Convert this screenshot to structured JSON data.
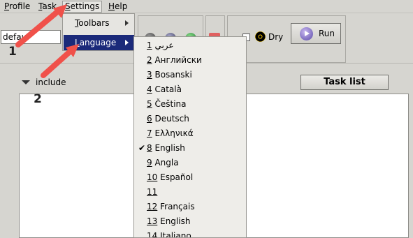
{
  "menubar": [
    {
      "label": "Profile",
      "underline": "P",
      "rest": "rofile"
    },
    {
      "label": "Task",
      "underline": "T",
      "rest": "ask"
    },
    {
      "label": "Settings",
      "underline": "S",
      "rest": "ettings"
    },
    {
      "label": "Help",
      "underline": "H",
      "rest": "elp"
    }
  ],
  "profile_field": {
    "value": "defaul"
  },
  "toolbar": {
    "dry_label": "Dry",
    "run_label": "Run"
  },
  "tree": {
    "include_label": "include"
  },
  "task_list_button": "Task list",
  "settings_menu": {
    "items": [
      {
        "underline": "T",
        "rest": "oolbars"
      },
      {
        "underline": "L",
        "rest": "anguage"
      }
    ]
  },
  "language_menu": [
    {
      "num": "1",
      "name": "عربي"
    },
    {
      "num": "2",
      "name": "Английски"
    },
    {
      "num": "3",
      "name": "Bosanski"
    },
    {
      "num": "4",
      "name": "Català"
    },
    {
      "num": "5",
      "name": "Čeština"
    },
    {
      "num": "6",
      "name": "Deutsch"
    },
    {
      "num": "7",
      "name": "Ελληνικά"
    },
    {
      "num": "8",
      "name": "English"
    },
    {
      "num": "9",
      "name": "Angla"
    },
    {
      "num": "10",
      "name": "Español"
    },
    {
      "num": "11",
      "name": ""
    },
    {
      "num": "12",
      "name": "Français"
    },
    {
      "num": "13",
      "name": "English"
    },
    {
      "num": "14",
      "name": "Italiano"
    }
  ],
  "checkmark": "✔",
  "callouts": {
    "one": "1",
    "two": "2"
  },
  "colors": {
    "arrow": "#f0514a",
    "selection": "#1b2a7a"
  }
}
